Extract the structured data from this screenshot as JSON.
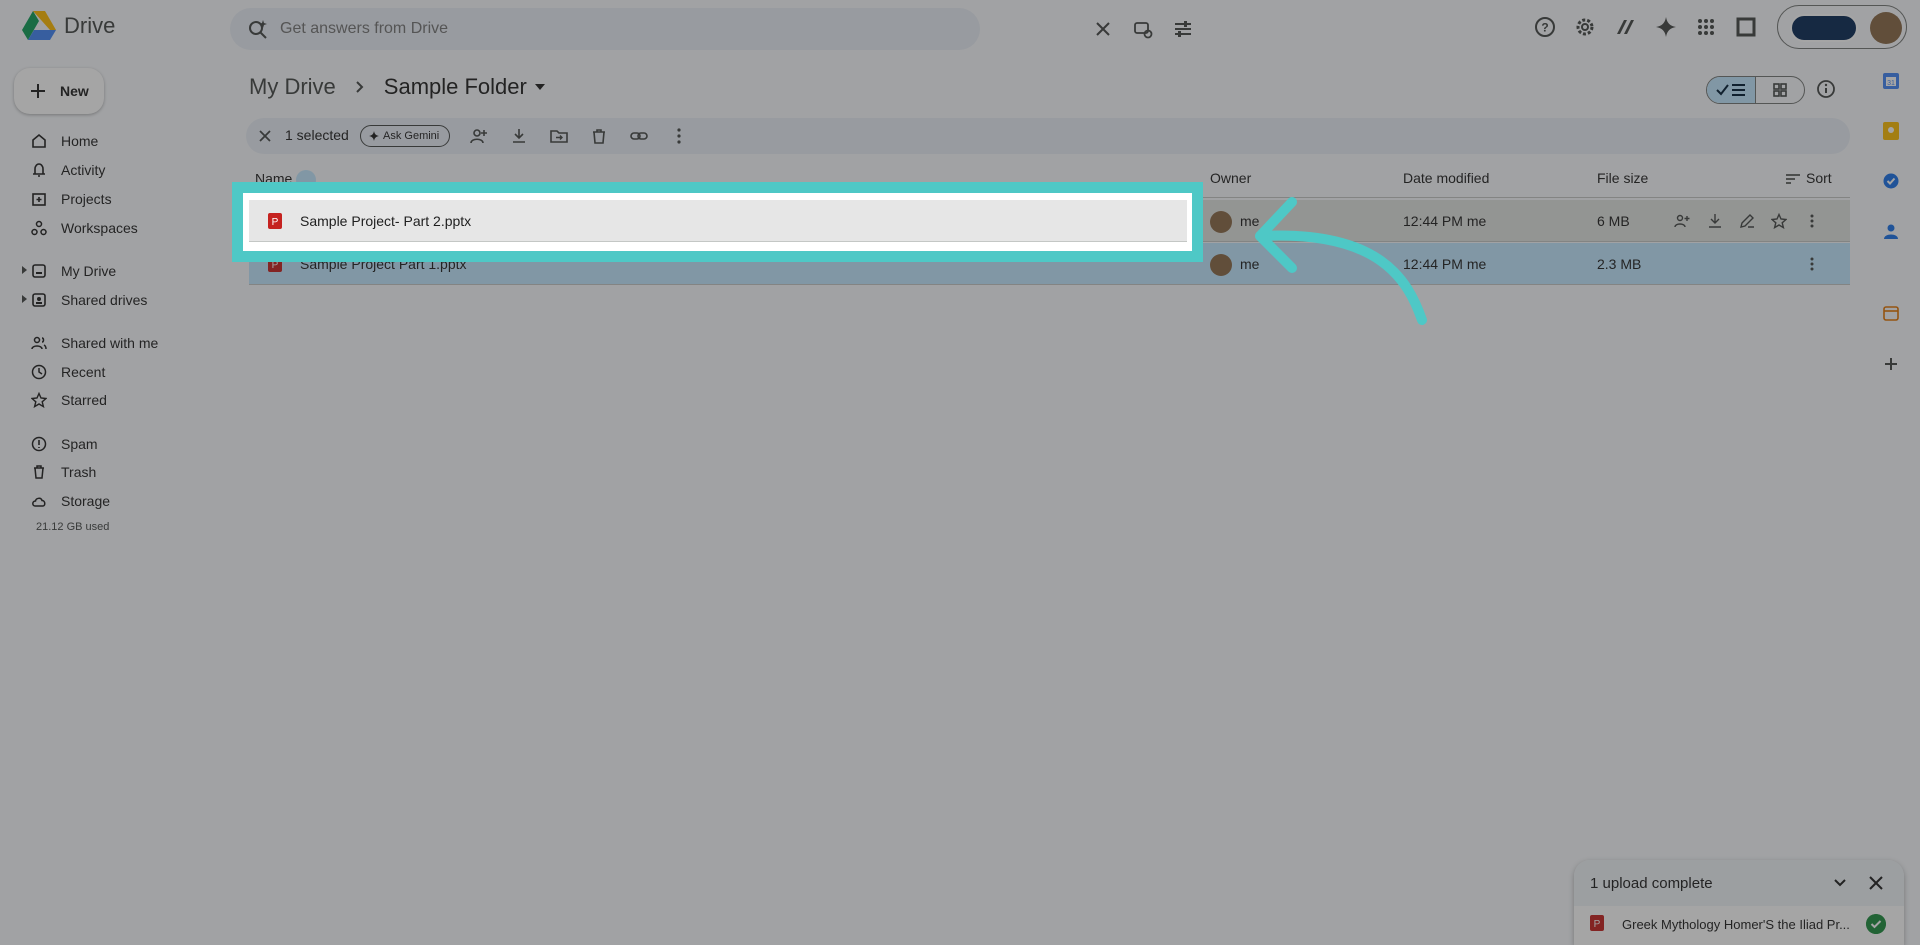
{
  "app": {
    "name": "Drive"
  },
  "search": {
    "placeholder": "Get answers from Drive"
  },
  "new_button": {
    "label": "New"
  },
  "sidebar": {
    "items": [
      {
        "label": "Home",
        "icon": "home-icon"
      },
      {
        "label": "Activity",
        "icon": "bell-icon"
      },
      {
        "label": "Projects",
        "icon": "projects-icon"
      },
      {
        "label": "Workspaces",
        "icon": "workspaces-icon"
      },
      {
        "label": "My Drive",
        "icon": "my-drive-icon"
      },
      {
        "label": "Shared drives",
        "icon": "shared-drives-icon"
      },
      {
        "label": "Shared with me",
        "icon": "people-icon"
      },
      {
        "label": "Recent",
        "icon": "clock-icon"
      },
      {
        "label": "Starred",
        "icon": "star-icon"
      },
      {
        "label": "Spam",
        "icon": "spam-icon"
      },
      {
        "label": "Trash",
        "icon": "trash-icon"
      },
      {
        "label": "Storage",
        "icon": "cloud-icon"
      }
    ],
    "storage_used": "21.12 GB used"
  },
  "breadcrumb": {
    "root": "My Drive",
    "current": "Sample Folder"
  },
  "selection_bar": {
    "count_label": "1 selected",
    "gemini_label": "Ask Gemini"
  },
  "table": {
    "headers": {
      "name": "Name",
      "owner": "Owner",
      "date": "Date modified",
      "size": "File size",
      "sort": "Sort"
    },
    "rows": [
      {
        "name": "Sample Project- Part 2.pptx",
        "owner": "me",
        "date": "12:44 PM me",
        "size": "6 MB"
      },
      {
        "name": "Sample Project Part 1.pptx",
        "owner": "me",
        "date": "12:44 PM me",
        "size": "2.3 MB"
      }
    ]
  },
  "upload_panel": {
    "title": "1 upload complete",
    "file": "Greek Mythology Homer'S the Iliad Pr..."
  },
  "colors": {
    "highlight": "#4ec8c6",
    "selected_row": "#c2e7ff",
    "accent": "#0b57d0"
  }
}
